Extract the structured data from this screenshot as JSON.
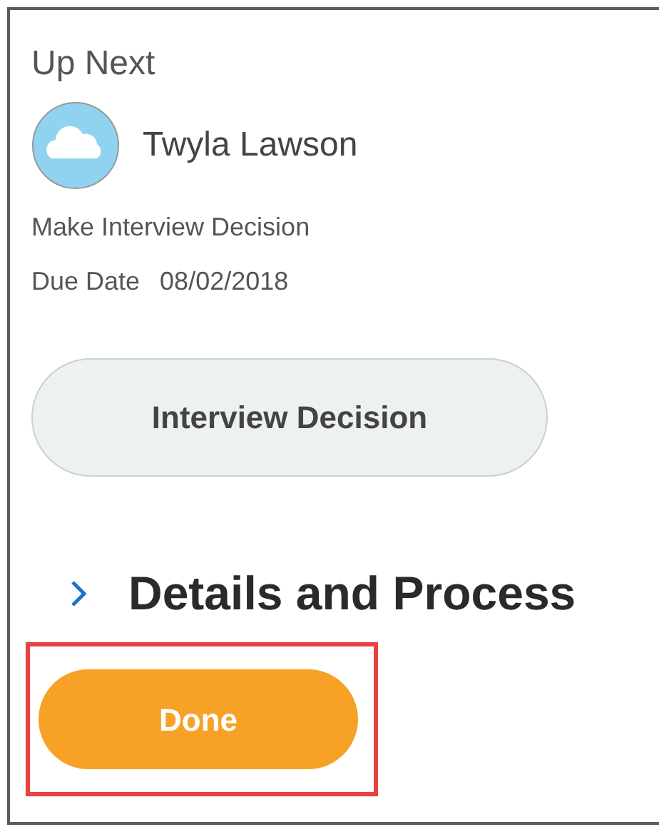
{
  "heading": "Up Next",
  "person": {
    "name": "Twyla Lawson"
  },
  "task": "Make Interview Decision",
  "due": {
    "label": "Due Date",
    "value": "08/02/2018"
  },
  "action_button": "Interview Decision",
  "section": {
    "title": "Details and Process",
    "expanded": false
  },
  "done_button": {
    "label": "Done",
    "highlighted": true
  }
}
